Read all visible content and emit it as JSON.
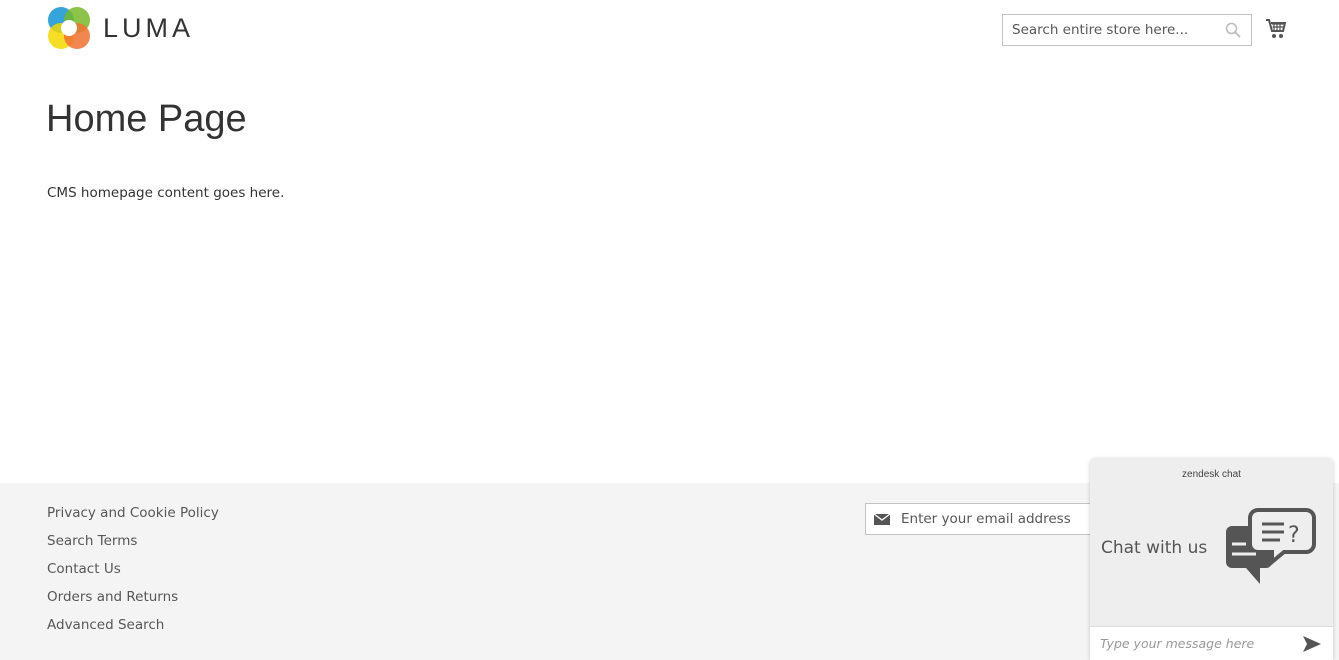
{
  "header": {
    "logo_text": "LUMA",
    "search_placeholder": "Search entire store here...",
    "cart_icon": "cart-icon",
    "search_icon": "search-icon"
  },
  "main": {
    "title": "Home Page",
    "content": "CMS homepage content goes here."
  },
  "footer": {
    "links": [
      "Privacy and Cookie Policy",
      "Search Terms",
      "Contact Us",
      "Orders and Returns",
      "Advanced Search"
    ],
    "email_placeholder": "Enter your email address"
  },
  "chat": {
    "brand": "zendesk chat",
    "title": "Chat with us",
    "input_placeholder": "Type your message here"
  }
}
